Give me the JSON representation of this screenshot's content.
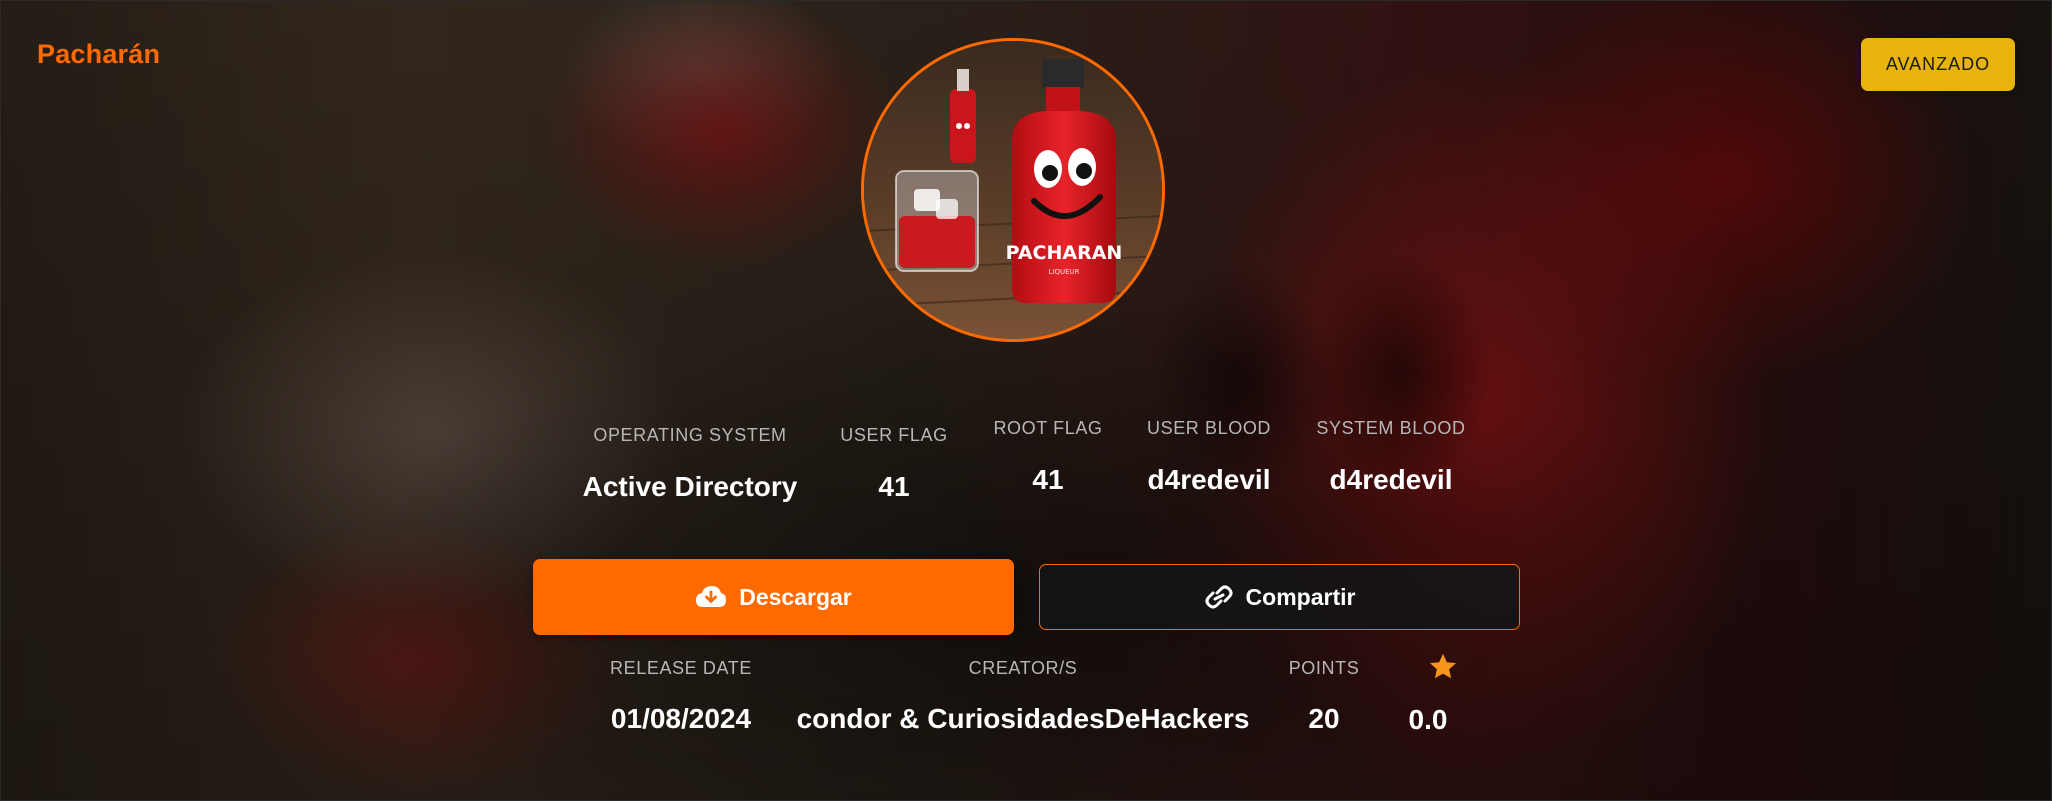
{
  "machine": {
    "name": "Pacharán",
    "difficulty": "AVANZADO"
  },
  "stats": {
    "os_label": "OPERATING SYSTEM",
    "os_value": "Active Directory",
    "user_flag_label": "USER FLAG",
    "user_flag_value": "41",
    "root_flag_label": "ROOT FLAG",
    "root_flag_value": "41",
    "user_blood_label": "USER BLOOD",
    "user_blood_value": "d4redevil",
    "system_blood_label": "SYSTEM BLOOD",
    "system_blood_value": "d4redevil"
  },
  "actions": {
    "download_label": "Descargar",
    "share_label": "Compartir"
  },
  "details": {
    "release_date_label": "RELEASE DATE",
    "release_date_value": "01/08/2024",
    "creators_label": "CREATOR/S",
    "creators_value": "condor & CuriosidadesDeHackers",
    "points_label": "POINTS",
    "points_value": "20",
    "rating_value": "0.0"
  },
  "avatar": {
    "label_text": "PACHARAN",
    "sub_text": "LIQUEUR"
  },
  "icons": {
    "download": "cloud-download-icon",
    "share": "link-icon",
    "rating": "star-icon"
  },
  "colors": {
    "accent": "#ff6a00",
    "difficulty_badge": "#e8b40c",
    "star": "#f7941d"
  }
}
